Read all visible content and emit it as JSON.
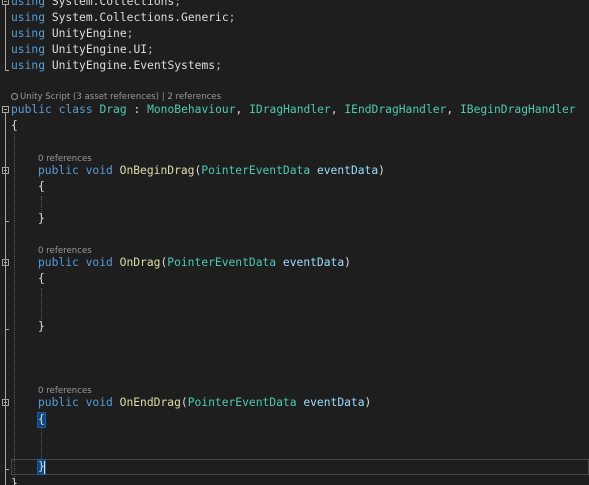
{
  "usings": [
    {
      "keyword": "using",
      "ns": "System.Collections",
      "end": ";"
    },
    {
      "keyword": "using",
      "ns": "System.Collections.Generic",
      "end": ";"
    },
    {
      "keyword": "using",
      "ns": "UnityEngine",
      "end": ";"
    },
    {
      "keyword": "using",
      "ns": "UnityEngine.UI",
      "end": ";"
    },
    {
      "keyword": "using",
      "ns": "UnityEngine.EventSystems",
      "end": ";"
    }
  ],
  "class_lens": {
    "unity_label": "Unity Script (3 asset references)",
    "separator": " | ",
    "refs_label": "2 references"
  },
  "class_decl": {
    "mod1": "public",
    "mod2": "class",
    "name": "Drag",
    "colon": " : ",
    "base1": "MonoBehaviour",
    "base2": "IDragHandler",
    "base3": "IEndDragHandler",
    "base4": "IBeginDragHandler",
    "comma": ", ",
    "open": "{",
    "close": "}"
  },
  "methods": [
    {
      "lens": "0 references",
      "access": "public",
      "ret": "void",
      "name": "OnBeginDrag",
      "param_type": "PointerEventData",
      "param_name": "eventData",
      "open": "{",
      "close": "}"
    },
    {
      "lens": "0 references",
      "access": "public",
      "ret": "void",
      "name": "OnDrag",
      "param_type": "PointerEventData",
      "param_name": "eventData",
      "open": "{",
      "close": "}"
    },
    {
      "lens": "0 references",
      "access": "public",
      "ret": "void",
      "name": "OnEndDrag",
      "param_type": "PointerEventData",
      "param_name": "eventData",
      "open": "{",
      "close": "}"
    }
  ],
  "punct": {
    "lparen": "(",
    "rparen": ")",
    "space": " "
  },
  "colors": {
    "background": "#1e1e1e",
    "keyword": "#569cd6",
    "type": "#4ec9b0",
    "method": "#dcdcaa",
    "parameter": "#9cdcfe",
    "text": "#dcdcdc",
    "codelens": "#999999",
    "brace_highlight": "#0e4583"
  },
  "icons": {
    "fold": "collapse-minus-icon",
    "unity": "unity-icon"
  }
}
